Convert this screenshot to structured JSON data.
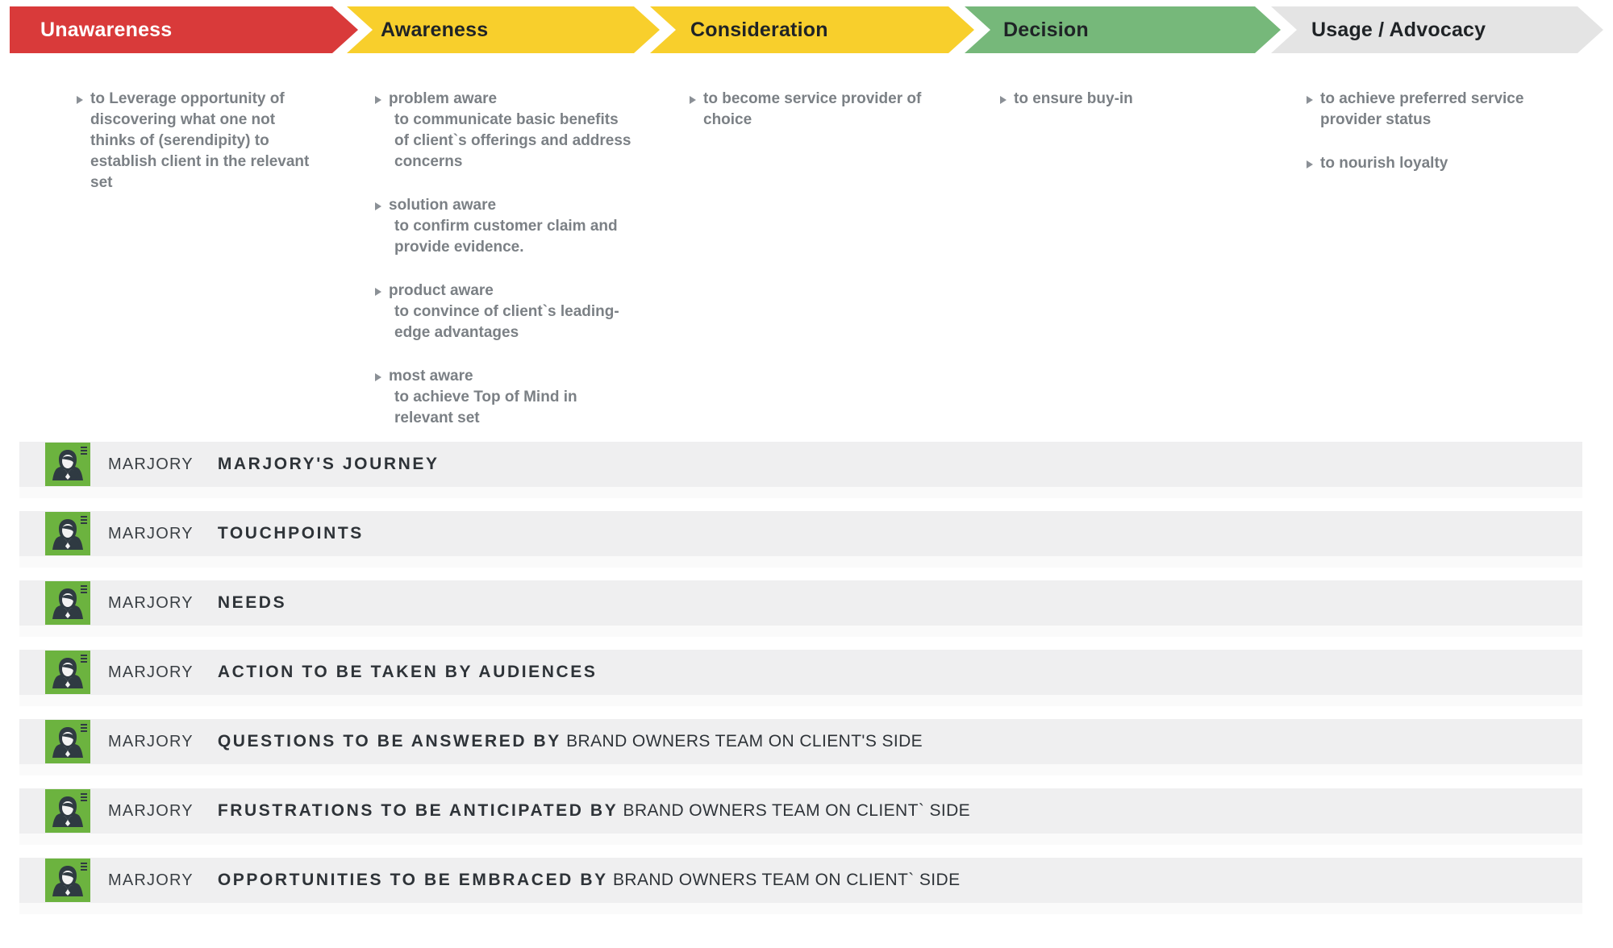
{
  "stages": [
    {
      "label": "Unawareness",
      "color": "#d93a3a",
      "text_color": "#ffffff"
    },
    {
      "label": "Awareness",
      "color": "#f8cf2c",
      "text_color": "#1f2326"
    },
    {
      "label": "Consideration",
      "color": "#f8cf2c",
      "text_color": "#1f2326"
    },
    {
      "label": "Decision",
      "color": "#76b87a",
      "text_color": "#1f2326"
    },
    {
      "label": "Usage / Advocacy",
      "color": "#e4e4e4",
      "text_color": "#1f2326"
    }
  ],
  "goals": {
    "unawareness": [
      {
        "head": "to Leverage opportunity of discovering what one not thinks of (serendipity) to establish client in the relevant set",
        "sub": ""
      }
    ],
    "awareness": [
      {
        "head": "problem aware",
        "sub": "to communicate basic benefits of client`s offerings and address concerns"
      },
      {
        "head": "solution aware",
        "sub": "to confirm customer claim and provide evidence."
      },
      {
        "head": "product aware",
        "sub": "to convince of client`s leading-edge advantages"
      },
      {
        "head": "most aware",
        "sub": "to achieve Top of Mind in relevant set"
      }
    ],
    "consideration": [
      {
        "head": "to become service provider of choice",
        "sub": ""
      }
    ],
    "decision": [
      {
        "head": "to ensure buy-in",
        "sub": ""
      }
    ],
    "usage_advocacy": [
      {
        "head": "to achieve preferred service provider status",
        "sub": ""
      },
      {
        "head": "to nourish loyalty",
        "sub": ""
      }
    ]
  },
  "rows": [
    {
      "persona": "MARJORY",
      "title_strong": "MARJORY'S JOURNEY",
      "title_plain": ""
    },
    {
      "persona": "MARJORY",
      "title_strong": "TOUCHPOINTS",
      "title_plain": ""
    },
    {
      "persona": "MARJORY",
      "title_strong": "NEEDS",
      "title_plain": ""
    },
    {
      "persona": "MARJORY",
      "title_strong": "ACTION TO BE TAKEN BY AUDIENCES",
      "title_plain": ""
    },
    {
      "persona": "MARJORY",
      "title_strong": "QUESTIONS TO BE ANSWERED BY",
      "title_plain": "BRAND OWNERS TEAM ON CLIENT'S SIDE"
    },
    {
      "persona": "MARJORY",
      "title_strong": "FRUSTRATIONS TO BE ANTICIPATED BY",
      "title_plain": "BRAND OWNERS TEAM ON CLIENT` SIDE"
    },
    {
      "persona": "MARJORY",
      "title_strong": "OPPORTUNITIES TO BE EMBRACED BY",
      "title_plain": "BRAND OWNERS TEAM ON CLIENT` SIDE"
    }
  ],
  "icons": {
    "avatar": "female-persona-icon",
    "bullet": "triangle-bullet-icon"
  },
  "colors": {
    "unawareness": "#d93a3a",
    "awareness": "#f8cf2c",
    "decision": "#76b87a",
    "usage": "#e4e4e4",
    "avatar_green": "#6cb33f",
    "band": "#efeff0"
  }
}
